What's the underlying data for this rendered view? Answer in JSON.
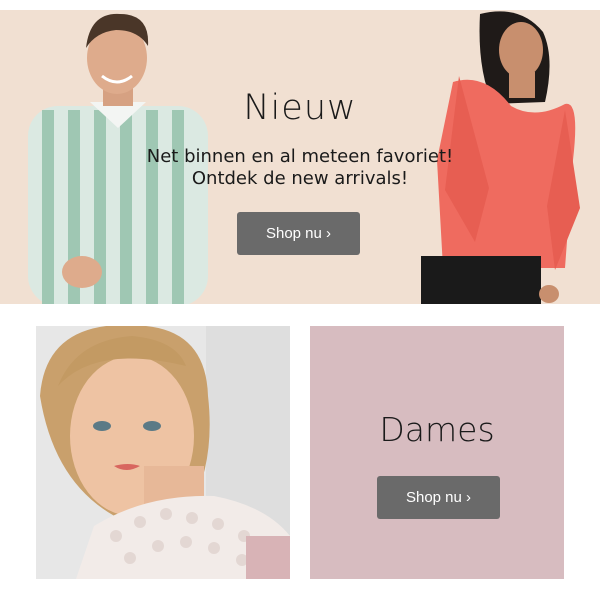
{
  "hero": {
    "title": "Nieuw",
    "subtitle_line1": "Net binnen en al meteen favoriet!",
    "subtitle_line2": "Ontdek de new arrivals!",
    "button_label": "Shop nu ›"
  },
  "dames": {
    "title": "Dames",
    "button_label": "Shop nu ›"
  },
  "colors": {
    "hero_background": "#f1e0d2",
    "dames_background": "#d7bcc0",
    "button_background": "#6a6a6a"
  }
}
